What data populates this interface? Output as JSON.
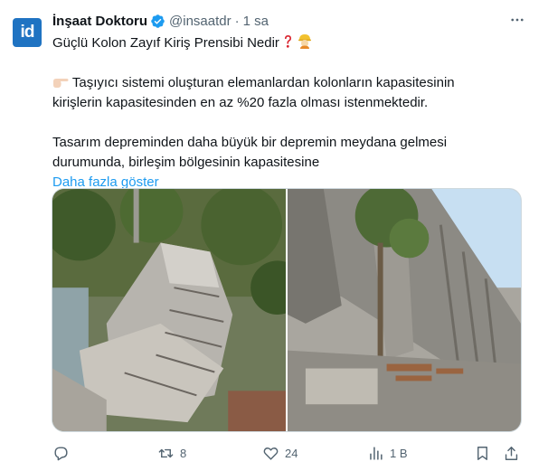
{
  "author": {
    "avatar_text": "id",
    "name": "İnşaat Doktoru",
    "handle": "@insaatdr",
    "separator": "·",
    "time": "1 sa"
  },
  "tweet": {
    "line1": "Güçlü Kolon Zayıf Kiriş Prensibi Nedir",
    "line2": "Taşıyıcı sistemi oluşturan elemanlardan kolonların kapasitesinin",
    "line3": "kirişlerin kapasitesinden en az %20 fazla olması istenmektedir.",
    "line4": "Tasarım depreminden daha büyük bir depremin meydana gelmesi",
    "line5": "durumunda, birleşim bölgesinin kapasitesine",
    "show_more": "Daha fazla göster"
  },
  "media": {
    "left_alt": "collapsed-building-photo",
    "right_alt": "collapsed-highway-photo"
  },
  "actions": {
    "reply_count": "",
    "retweet_count": "8",
    "like_count": "24",
    "views_count": "1 B"
  },
  "colors": {
    "accent": "#1d9bf0",
    "muted": "#536471",
    "badge": "#1d9bf0",
    "avatar_bg": "#1f73c2"
  }
}
